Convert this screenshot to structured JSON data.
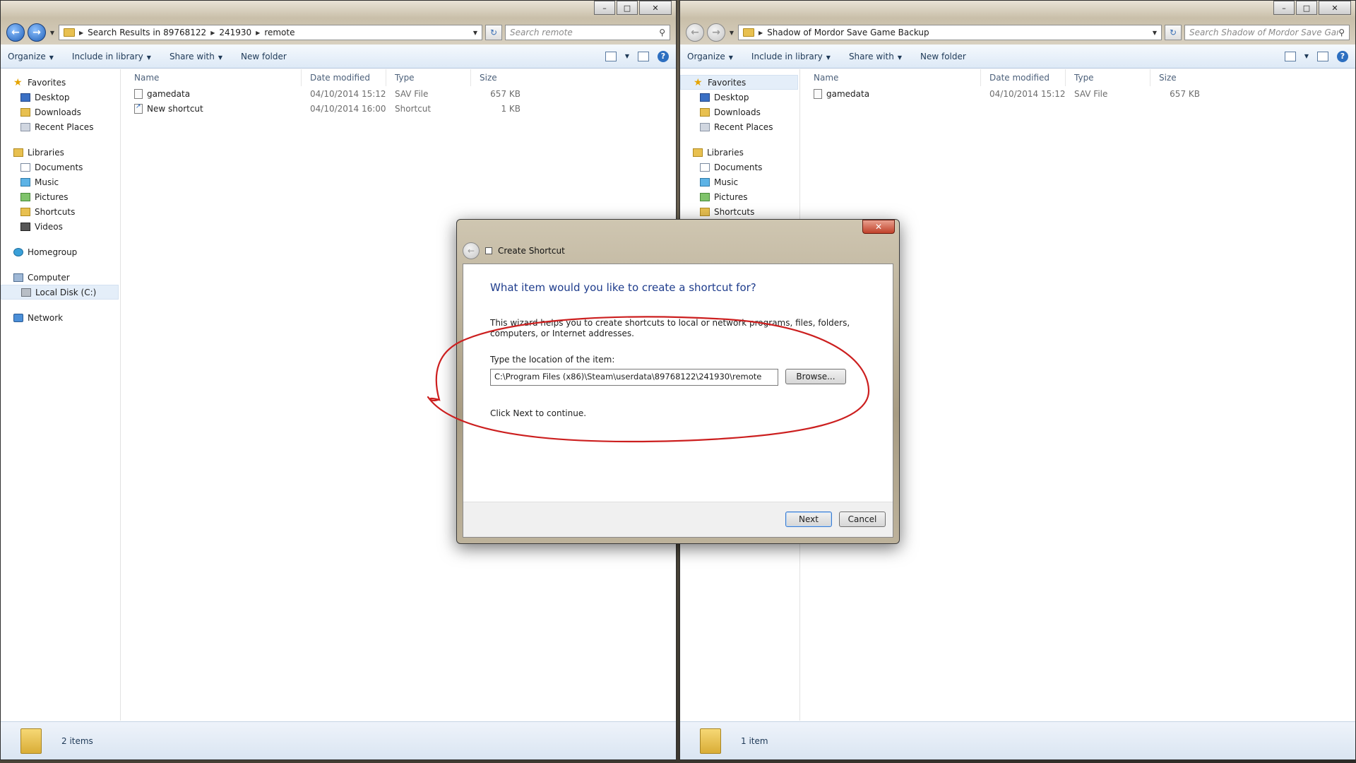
{
  "left_window": {
    "breadcrumbs": [
      "Search Results in 89768122",
      "241930",
      "remote"
    ],
    "search_placeholder": "Search remote",
    "toolbar": {
      "organize": "Organize",
      "include": "Include in library",
      "share": "Share with",
      "new_folder": "New folder"
    },
    "columns": {
      "name": "Name",
      "date": "Date modified",
      "type": "Type",
      "size": "Size"
    },
    "files": [
      {
        "name": "gamedata",
        "date": "04/10/2014 15:12",
        "type": "SAV File",
        "size": "657 KB"
      },
      {
        "name": "New shortcut",
        "date": "04/10/2014 16:00",
        "type": "Shortcut",
        "size": "1 KB"
      }
    ],
    "status": "2 items"
  },
  "right_window": {
    "breadcrumbs": [
      "Shadow of Mordor Save Game Backup"
    ],
    "search_placeholder": "Search Shadow of Mordor Save Gam...",
    "toolbar": {
      "organize": "Organize",
      "include": "Include in library",
      "share": "Share with",
      "new_folder": "New folder"
    },
    "columns": {
      "name": "Name",
      "date": "Date modified",
      "type": "Type",
      "size": "Size"
    },
    "files": [
      {
        "name": "gamedata",
        "date": "04/10/2014 15:12",
        "type": "SAV File",
        "size": "657 KB"
      }
    ],
    "status": "1 item"
  },
  "nav": {
    "favorites": "Favorites",
    "desktop": "Desktop",
    "downloads": "Downloads",
    "recent": "Recent Places",
    "libraries": "Libraries",
    "documents": "Documents",
    "music": "Music",
    "pictures": "Pictures",
    "shortcuts": "Shortcuts",
    "videos": "Videos",
    "homegroup": "Homegroup",
    "computer": "Computer",
    "local_disk": "Local Disk (C:)",
    "network": "Network"
  },
  "dialog": {
    "title": "Create Shortcut",
    "heading": "What item would you like to create a shortcut for?",
    "description": "This wizard helps you to create shortcuts to local or network programs, files, folders, computers, or Internet addresses.",
    "location_label": "Type the location of the item:",
    "location_value": "C:\\Program Files (x86)\\Steam\\userdata\\89768122\\241930\\remote",
    "browse": "Browse...",
    "note": "Click Next to continue.",
    "next": "Next",
    "cancel": "Cancel"
  },
  "icons": {
    "minimize": "minimize-icon",
    "maximize": "maximize-icon",
    "close": "close-icon",
    "back": "back-arrow-icon",
    "forward": "forward-arrow-icon",
    "refresh": "refresh-icon",
    "search": "search-icon",
    "help": "help-icon",
    "folder": "folder-icon"
  },
  "colors": {
    "accent_blue": "#1f5fb8",
    "annotation_red": "#cc1f1f",
    "heading_blue": "#1e3c8c"
  }
}
